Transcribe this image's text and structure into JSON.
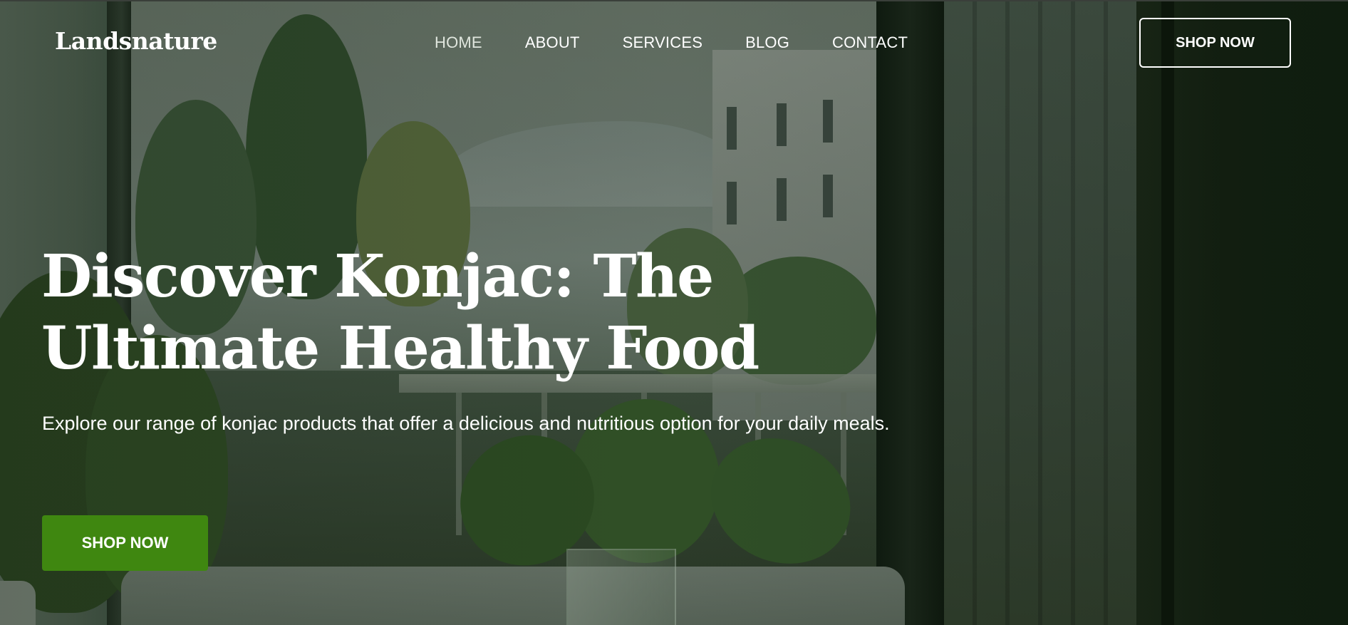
{
  "header": {
    "logo_text": "Landsnature",
    "nav": [
      {
        "label": "HOME"
      },
      {
        "label": "ABOUT"
      },
      {
        "label": "SERVICES"
      },
      {
        "label": "BLOG"
      },
      {
        "label": "CONTACT"
      }
    ],
    "shop_button_label": "SHOP NOW"
  },
  "hero": {
    "title_line1": "Discover Konjac: The",
    "title_line2": "Ultimate Healthy Food",
    "subtitle": "Explore our range of konjac products that offer a delicious and nutritious option for your daily meals.",
    "cta_label": "SHOP NOW"
  },
  "colors": {
    "cta_background": "#3f8710",
    "text": "#ffffff",
    "overlay_tint": "#1c2a1a"
  }
}
